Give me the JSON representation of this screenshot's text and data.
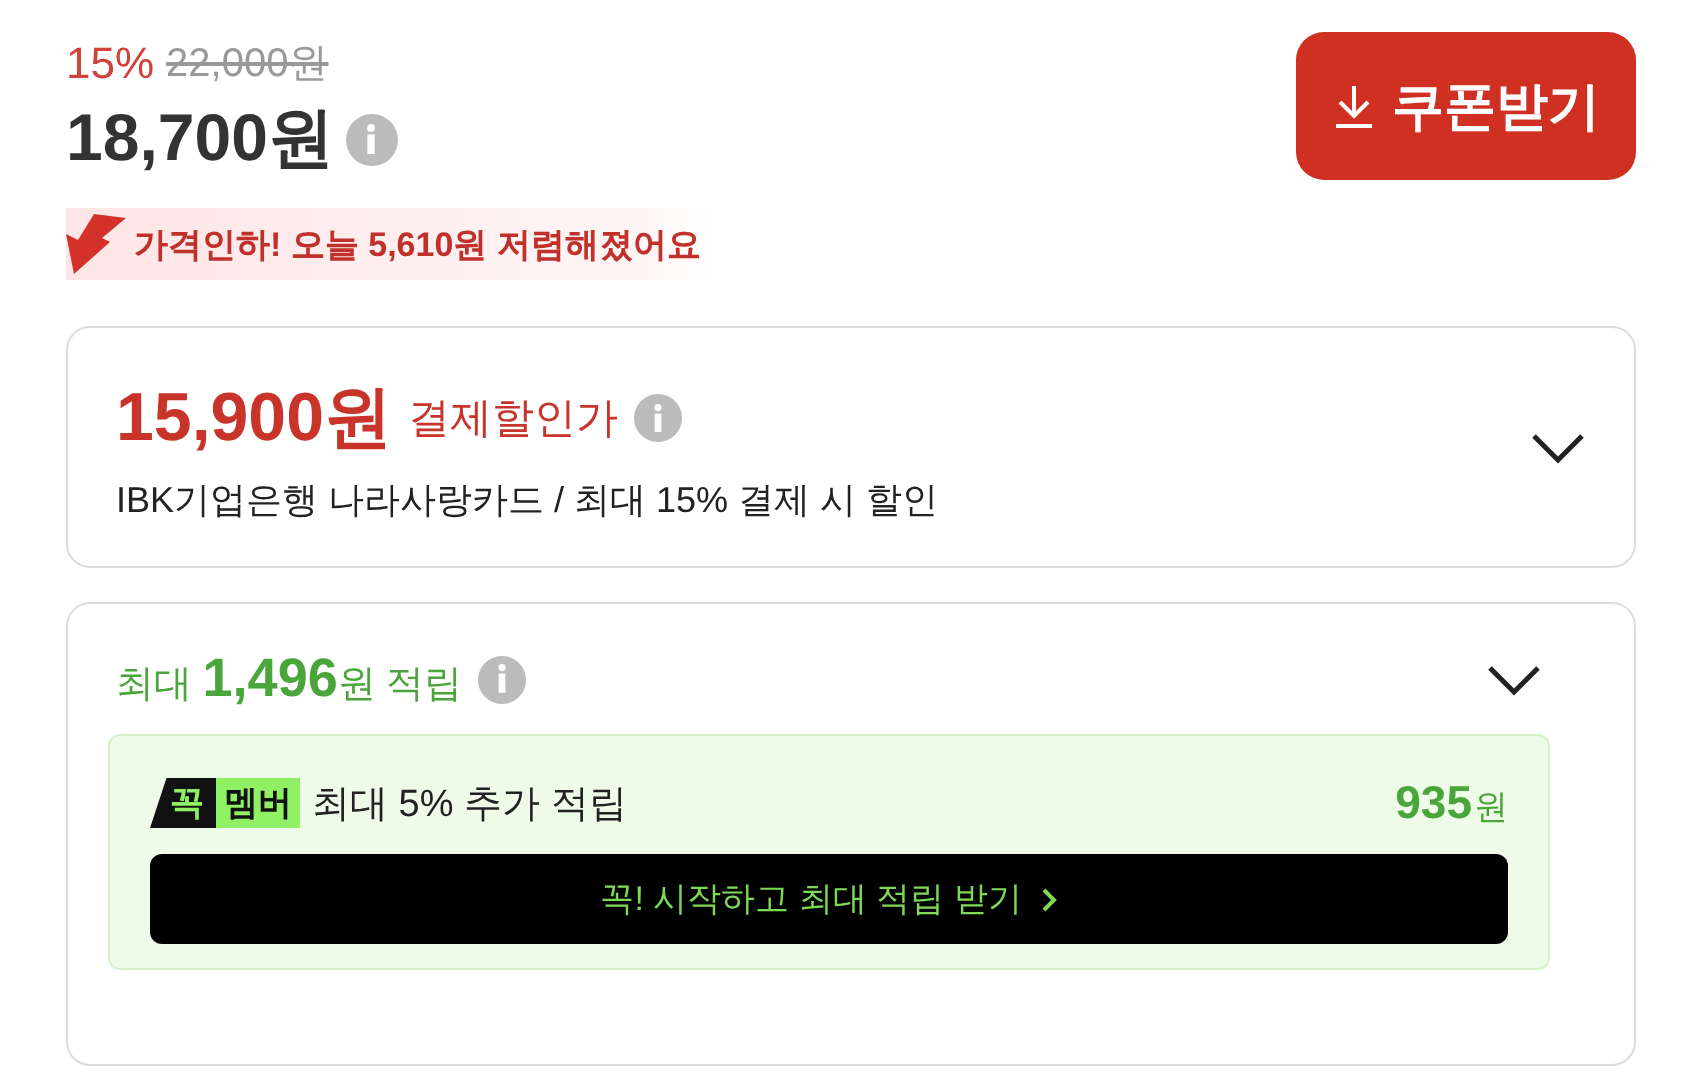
{
  "price": {
    "discount": "15%",
    "original": "22,000원",
    "final": "18,700원"
  },
  "price_drop_banner": "가격인하! 오늘 **5,610**원 저렴해졌어요",
  "coupon_button": {
    "label": "쿠폰받기"
  },
  "payment_card": {
    "price": "15,900원",
    "label": "결제할인가",
    "description": "IBK기업은행 나라사랑카드 / 최대 15% 결제 시 할인",
    "expanded": false
  },
  "reward_card": {
    "title": "최대 **1,496**원 적립",
    "expanded": false,
    "member": {
      "badge_left": "꼭",
      "badge_right": "멤버",
      "text": "최대 5% 추가 적립",
      "amount": "935",
      "unit": "원",
      "cta": "꼭! 시작하고 최대 적립 받기"
    }
  }
}
